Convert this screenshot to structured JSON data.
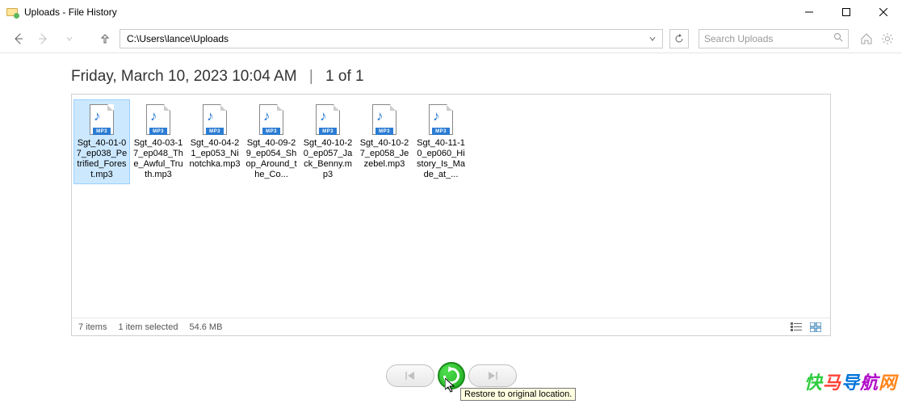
{
  "window": {
    "title": "Uploads - File History"
  },
  "toolbar": {
    "path": "C:\\Users\\lance\\Uploads"
  },
  "search": {
    "placeholder": "Search Uploads"
  },
  "header": {
    "timestamp": "Friday, March 10, 2023 10:04 AM",
    "page_indicator": "1 of 1"
  },
  "files": [
    {
      "label": "Sgt_40-01-07_ep038_Petrified_Forest.mp3",
      "badge": "MP3",
      "selected": true
    },
    {
      "label": "Sgt_40-03-17_ep048_The_Awful_Truth.mp3",
      "badge": "MP3",
      "selected": false
    },
    {
      "label": "Sgt_40-04-21_ep053_Ninotchka.mp3",
      "badge": "MP3",
      "selected": false
    },
    {
      "label": "Sgt_40-09-29_ep054_Shop_Around_the_Co...",
      "badge": "MP3",
      "selected": false
    },
    {
      "label": "Sgt_40-10-20_ep057_Jack_Benny.mp3",
      "badge": "MP3",
      "selected": false
    },
    {
      "label": "Sgt_40-10-27_ep058_Jezebel.mp3",
      "badge": "MP3",
      "selected": false
    },
    {
      "label": "Sgt_40-11-10_ep060_History_Is_Made_at_...",
      "badge": "MP3",
      "selected": false
    }
  ],
  "status": {
    "item_count": "7 items",
    "selected": "1 item selected",
    "size": "54.6 MB"
  },
  "tooltip": {
    "text": "Restore to original location."
  },
  "watermark": {
    "text": "快马导航网"
  }
}
